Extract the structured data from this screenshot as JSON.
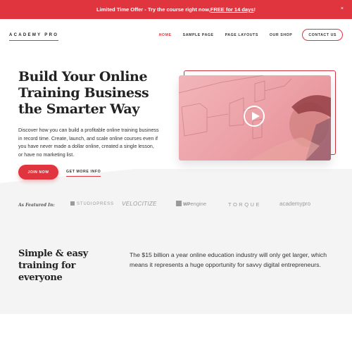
{
  "announcement": {
    "text": "Limited Time Offer - Try the course right now, ",
    "link": "FREE for 14 days",
    "suffix": "!",
    "close": "×"
  },
  "header": {
    "logo": "ACADEMY PRO",
    "nav": [
      {
        "label": "HOME",
        "active": true
      },
      {
        "label": "SAMPLE PAGE"
      },
      {
        "label": "PAGE LAYOUTS"
      },
      {
        "label": "OUR SHOP"
      },
      {
        "label": "CONTACT US"
      }
    ]
  },
  "hero": {
    "title": "Build Your Online Training Business the Smarter Way",
    "text": "Discover how you can build a profitable online training business in record time. Create, launch, and scale online courses even if you have never made a dollar online, created a single lesson, or have no marketing list.",
    "primary_button": "JOIN NOW",
    "secondary_button": "GET MORE INFO",
    "video": {
      "icon": "play-icon"
    }
  },
  "featured": {
    "label": "As Featured In:",
    "logos": [
      "STUDIOPRESS",
      "VELOCITIZE",
      "WPengine",
      "TORQUE",
      "academypro"
    ],
    "wp_bold": "WP",
    "wp_rest": "engine"
  },
  "intro": {
    "title": "Simple & easy training for everyone",
    "text": "The $15 billion a year online education industry will only get larger, which means it represents a huge opportunity for savvy digital entrepreneurs."
  },
  "colors": {
    "accent": "#e0343f",
    "grey_bg": "#f4f4f4"
  }
}
